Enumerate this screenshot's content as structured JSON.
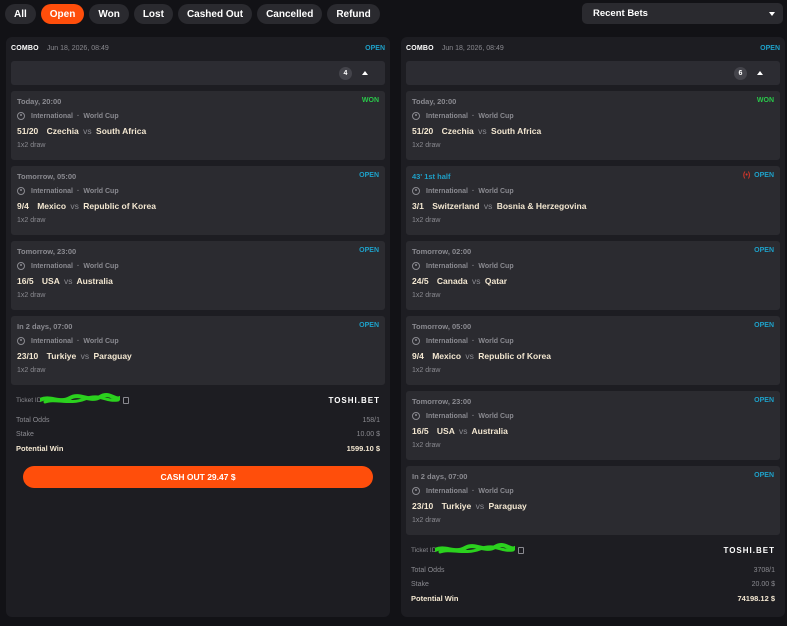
{
  "filters": [
    "All",
    "Open",
    "Won",
    "Lost",
    "Cashed Out",
    "Cancelled",
    "Refund"
  ],
  "active_filter": "Open",
  "dropdown": {
    "selected": "Recent Bets"
  },
  "colors": {
    "accent": "#ff4e0b",
    "open": "#1ea0c8",
    "won": "#29c84a",
    "live": "#e0372a"
  },
  "bets": [
    {
      "type": "COMBO",
      "date": "Jun 18, 2026, 08:49",
      "status": "OPEN",
      "legs_count": "4",
      "legs": [
        {
          "time": "Today, 20:00",
          "status": "WON",
          "competition": "International",
          "league": "World Cup",
          "odds": "51/20",
          "home": "Czechia",
          "away": "South Africa",
          "market": "1x2 draw"
        },
        {
          "time": "Tomorrow, 05:00",
          "status": "OPEN",
          "competition": "International",
          "league": "World Cup",
          "odds": "9/4",
          "home": "Mexico",
          "away": "Republic of Korea",
          "market": "1x2 draw"
        },
        {
          "time": "Tomorrow, 23:00",
          "status": "OPEN",
          "competition": "International",
          "league": "World Cup",
          "odds": "16/5",
          "home": "USA",
          "away": "Australia",
          "market": "1x2 draw"
        },
        {
          "time": "In 2 days, 07:00",
          "status": "OPEN",
          "competition": "International",
          "league": "World Cup",
          "odds": "23/10",
          "home": "Turkiye",
          "away": "Paraguay",
          "market": "1x2 draw"
        }
      ],
      "ticket_label": "Ticket ID",
      "brand": "TOSHI.BET",
      "total_odds_label": "Total Odds",
      "total_odds": "158/1",
      "stake_label": "Stake",
      "stake": "10.00 $",
      "potential_label": "Potential Win",
      "potential_win": "1599.10 $",
      "cashout": "CASH OUT 29.47 $"
    },
    {
      "type": "COMBO",
      "date": "Jun 18, 2026, 08:49",
      "status": "OPEN",
      "legs_count": "6",
      "legs": [
        {
          "time": "Today, 20:00",
          "status": "WON",
          "competition": "International",
          "league": "World Cup",
          "odds": "51/20",
          "home": "Czechia",
          "away": "South Africa",
          "market": "1x2 draw"
        },
        {
          "time": "43' 1st half",
          "status": "OPEN",
          "live": "(•)",
          "competition": "International",
          "league": "World Cup",
          "odds": "3/1",
          "home": "Switzerland",
          "away": "Bosnia & Herzegovina",
          "market": "1x2 draw"
        },
        {
          "time": "Tomorrow, 02:00",
          "status": "OPEN",
          "competition": "International",
          "league": "World Cup",
          "odds": "24/5",
          "home": "Canada",
          "away": "Qatar",
          "market": "1x2 draw"
        },
        {
          "time": "Tomorrow, 05:00",
          "status": "OPEN",
          "competition": "International",
          "league": "World Cup",
          "odds": "9/4",
          "home": "Mexico",
          "away": "Republic of Korea",
          "market": "1x2 draw"
        },
        {
          "time": "Tomorrow, 23:00",
          "status": "OPEN",
          "competition": "International",
          "league": "World Cup",
          "odds": "16/5",
          "home": "USA",
          "away": "Australia",
          "market": "1x2 draw"
        },
        {
          "time": "In 2 days, 07:00",
          "status": "OPEN",
          "competition": "International",
          "league": "World Cup",
          "odds": "23/10",
          "home": "Turkiye",
          "away": "Paraguay",
          "market": "1x2 draw"
        }
      ],
      "ticket_label": "Ticket ID",
      "brand": "TOSHI.BET",
      "total_odds_label": "Total Odds",
      "total_odds": "3708/1",
      "stake_label": "Stake",
      "stake": "20.00 $",
      "potential_label": "Potential Win",
      "potential_win": "74198.12 $"
    }
  ]
}
